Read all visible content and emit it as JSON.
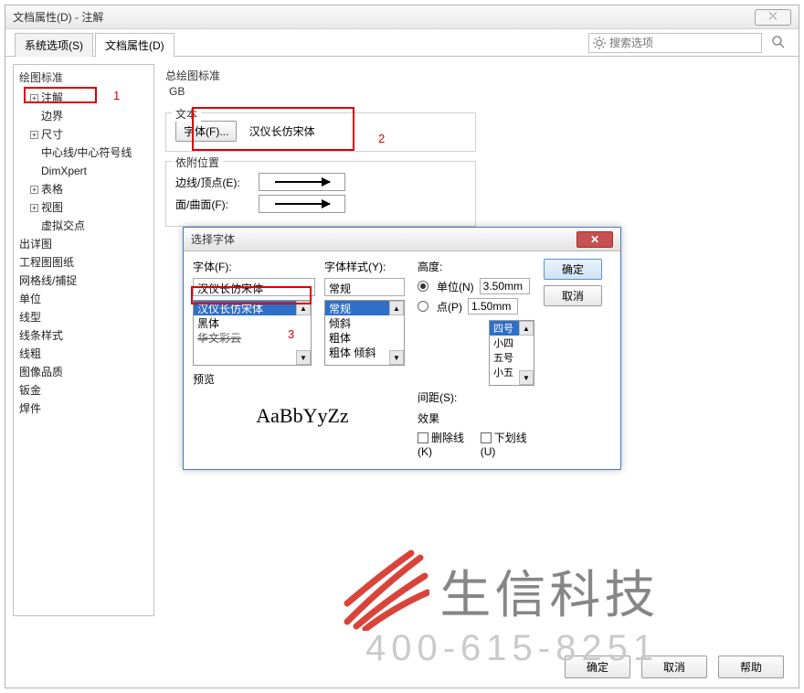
{
  "window": {
    "title": "文档属性(D) - 注解",
    "close_label": "⤬"
  },
  "tabs": {
    "system": "系统选项(S)",
    "doc": "文档属性(D)"
  },
  "search": {
    "placeholder": "搜索选项"
  },
  "tree": {
    "header": "绘图标准",
    "items": [
      {
        "label": "注解",
        "exp": true,
        "indent": 1
      },
      {
        "label": "边界",
        "exp": false,
        "indent": 2
      },
      {
        "label": "尺寸",
        "exp": true,
        "indent": 1
      },
      {
        "label": "中心线/中心符号线",
        "exp": false,
        "indent": 2
      },
      {
        "label": "DimXpert",
        "exp": false,
        "indent": 2
      },
      {
        "label": "表格",
        "exp": true,
        "indent": 1
      },
      {
        "label": "视图",
        "exp": true,
        "indent": 1
      },
      {
        "label": "虚拟交点",
        "exp": false,
        "indent": 2
      },
      {
        "label": "出详图",
        "exp": false,
        "indent": 0
      },
      {
        "label": "工程图图纸",
        "exp": false,
        "indent": 0
      },
      {
        "label": "网格线/捕捉",
        "exp": false,
        "indent": 0
      },
      {
        "label": "单位",
        "exp": false,
        "indent": 0
      },
      {
        "label": "线型",
        "exp": false,
        "indent": 0
      },
      {
        "label": "线条样式",
        "exp": false,
        "indent": 0
      },
      {
        "label": "线粗",
        "exp": false,
        "indent": 0
      },
      {
        "label": "图像品质",
        "exp": false,
        "indent": 0
      },
      {
        "label": "钣金",
        "exp": false,
        "indent": 0
      },
      {
        "label": "焊件",
        "exp": false,
        "indent": 0
      }
    ]
  },
  "main": {
    "std_label": "总绘图标准",
    "std_value": "GB",
    "text_label": "文本",
    "font_btn": "字体(F)...",
    "font_name": "汉仪长仿宋体",
    "attach_label": "依附位置",
    "edge_label": "边线/顶点(E):",
    "face_label": "面/曲面(F):"
  },
  "anno": {
    "a1": "1",
    "a2": "2",
    "a3": "3"
  },
  "fontdlg": {
    "title": "选择字体",
    "font_label": "字体(F):",
    "font_value": "汉仪长仿宋体",
    "fonts": [
      "汉仪长仿宋体",
      "黑体",
      "华文彩云"
    ],
    "style_label": "字体样式(Y):",
    "style_value": "常规",
    "styles": [
      "常规",
      "倾斜",
      "粗体",
      "粗体 倾斜"
    ],
    "height_label": "高度:",
    "unit_label": "单位(N)",
    "unit_value": "3.50mm",
    "point_label": "点(P)",
    "point_value": "1.50mm",
    "sizes": [
      "四号",
      "小四",
      "五号",
      "小五"
    ],
    "spacing_label": "间距(S):",
    "effect_label": "效果",
    "strike_label": "删除线(K)",
    "under_label": "下划线(U)",
    "preview_label": "预览",
    "preview_text": "AaBbYyZz",
    "ok": "确定",
    "cancel": "取消"
  },
  "buttons": {
    "ok": "确定",
    "cancel": "取消",
    "help": "帮助"
  },
  "watermark": {
    "brand": "生信科技",
    "tel": "400-615-8251"
  }
}
